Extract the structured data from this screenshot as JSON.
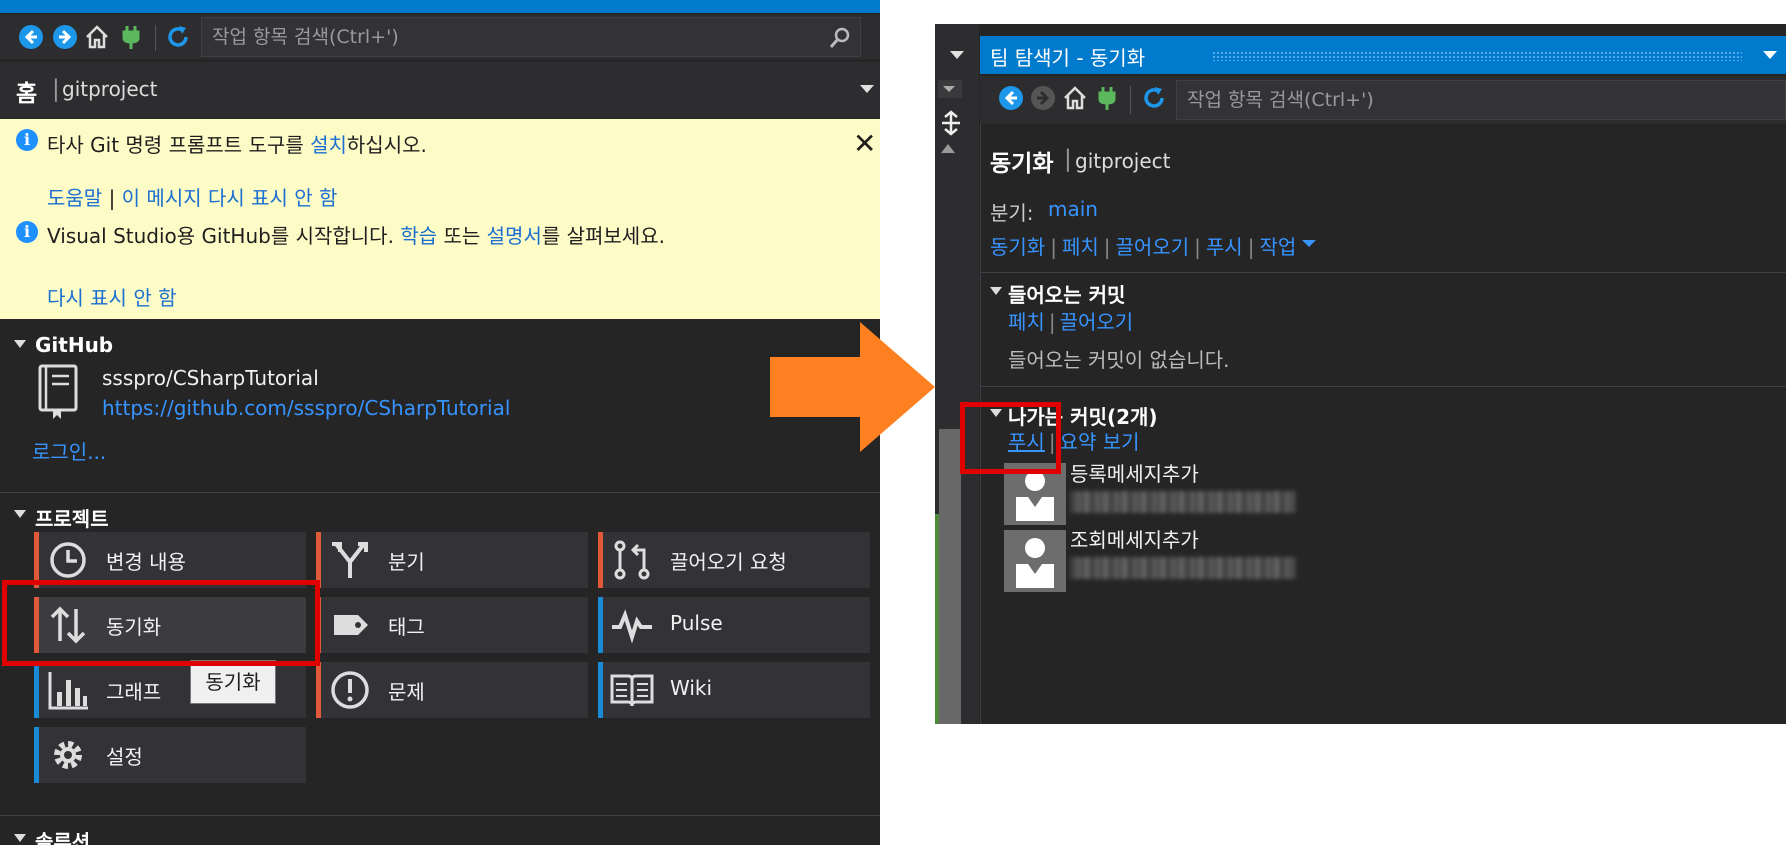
{
  "left": {
    "search_placeholder": "작업 항목 검색(Ctrl+')",
    "page_title": "홈",
    "separator": "|",
    "project_name": "gitproject",
    "info1": {
      "prefix": "타사 Git 명령 프롬프트 도구를 ",
      "link": "설치",
      "suffix": "하십시오."
    },
    "info_links": {
      "help": "도움말",
      "sep": "|",
      "dont_show": "이 메시지 다시 표시 안 함"
    },
    "info2": {
      "prefix": "Visual Studio용 GitHub를 시작합니다. ",
      "link1": "학습",
      "mid": " 또는 ",
      "link2": "설명서",
      "suffix": "를 살펴보세요."
    },
    "info2_dismiss": "다시 표시 안 함",
    "github": {
      "title": "GitHub",
      "repo": "ssspro/CSharpTutorial",
      "url": "https://github.com/ssspro/CSharpTutorial",
      "login": "로그인..."
    },
    "project": {
      "title": "프로젝트",
      "tiles": [
        {
          "label": "변경 내용",
          "icon": "clock-icon",
          "accent": "#e05a3a"
        },
        {
          "label": "분기",
          "icon": "branch-icon",
          "accent": "#e05a3a"
        },
        {
          "label": "끌어오기 요청",
          "icon": "pull-request-icon",
          "accent": "#e05a3a"
        },
        {
          "label": "동기화",
          "icon": "sync-arrows-icon",
          "accent": "#e05a3a"
        },
        {
          "label": "태그",
          "icon": "tag-icon",
          "accent": "#e05a3a"
        },
        {
          "label": "Pulse",
          "icon": "pulse-icon",
          "accent": "#1a8ad4"
        },
        {
          "label": "그래프",
          "icon": "bar-graph-icon",
          "accent": "#1a8ad4"
        },
        {
          "label": "문제",
          "icon": "issue-icon",
          "accent": "#e05a3a"
        },
        {
          "label": "Wiki",
          "icon": "book-icon",
          "accent": "#1a8ad4"
        },
        {
          "label": "설정",
          "icon": "gear-icon",
          "accent": "#1a8ad4"
        }
      ],
      "tooltip": "동기화"
    },
    "solution_title": "솔루션"
  },
  "right": {
    "tab_title": "팀 탐색기 - 동기화",
    "search_placeholder": "작업 항목 검색(Ctrl+')",
    "page_title": "동기화",
    "separator": "|",
    "project_name": "gitproject",
    "branch_label": "분기:",
    "branch_name": "main",
    "actions": [
      "동기화",
      "페치",
      "끌어오기",
      "푸시",
      "작업"
    ],
    "incoming": {
      "title": "들어오는 커밋",
      "links": [
        "페치",
        "끌어오기"
      ],
      "empty": "들어오는 커밋이 없습니다."
    },
    "outgoing": {
      "title": "나가는 커밋(2개)",
      "links": [
        "푸시",
        "요약 보기"
      ],
      "commits": [
        {
          "message": "등록메세지추가"
        },
        {
          "message": "조회메세지추가"
        }
      ]
    }
  },
  "colors": {
    "accent_blue": "#007acc",
    "link": "#3794ff",
    "highlight_red": "#e00000",
    "arrow_orange": "#ff8020",
    "info_bar": "#fdfbc6"
  }
}
